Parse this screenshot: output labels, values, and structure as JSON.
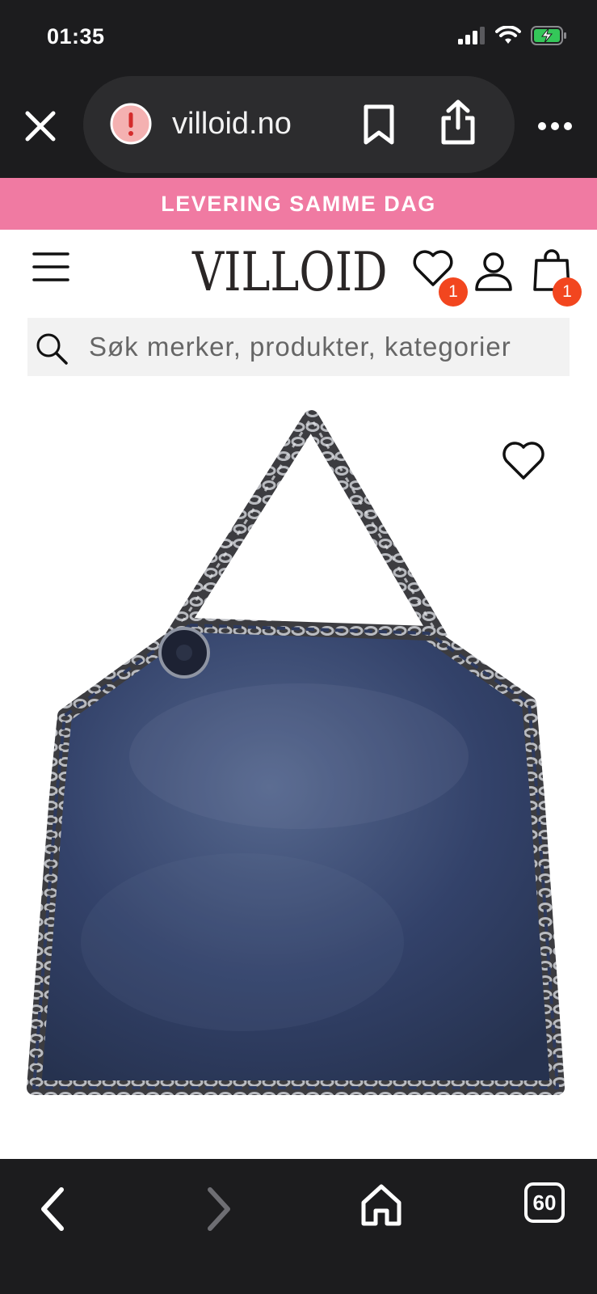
{
  "status_bar": {
    "time": "01:35"
  },
  "browser": {
    "url": "villoid.no",
    "tab_count": "60"
  },
  "promo": {
    "text": "LEVERING SAMME DAG"
  },
  "header": {
    "logo": "VILLOID",
    "wishlist_count": "1",
    "cart_count": "1"
  },
  "search": {
    "placeholder": "Søk merker, produkter, kategorier"
  },
  "colors": {
    "promo_bg": "#f07aa2",
    "badge": "#f2461f",
    "chrome_bg": "#1c1c1e",
    "bag": "#2b3a5a"
  },
  "icons": [
    "close-icon",
    "warning-icon",
    "bookmark-icon",
    "share-icon",
    "more-icon",
    "menu-icon",
    "heart-icon",
    "user-icon",
    "shopping-bag-icon",
    "search-icon",
    "back-icon",
    "forward-icon",
    "home-icon",
    "tabs-icon"
  ]
}
